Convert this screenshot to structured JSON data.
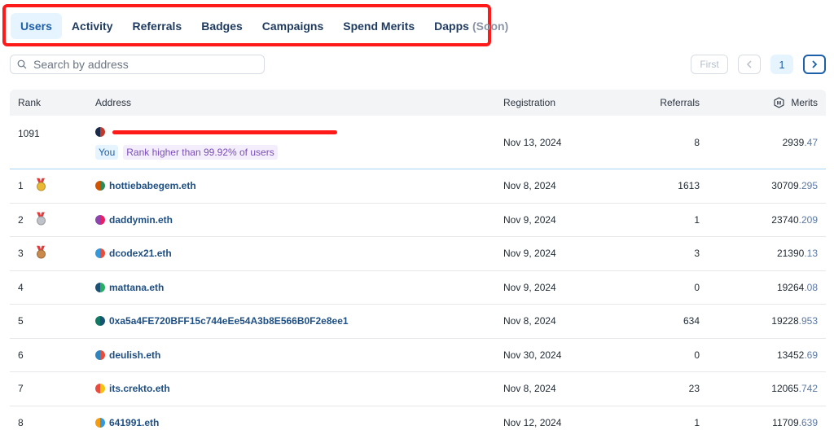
{
  "tabs": [
    {
      "label": "Users",
      "active": true
    },
    {
      "label": "Activity"
    },
    {
      "label": "Referrals"
    },
    {
      "label": "Badges"
    },
    {
      "label": "Campaigns"
    },
    {
      "label": "Spend Merits"
    },
    {
      "label": "Dapps",
      "suffix": "(Soon)"
    }
  ],
  "search": {
    "placeholder": "Search by address",
    "value": ""
  },
  "pagination": {
    "first": "First",
    "current_page": "1"
  },
  "table": {
    "headers": {
      "rank": "Rank",
      "address": "Address",
      "registration": "Registration",
      "referrals": "Referrals",
      "merits": "Merits"
    },
    "you_row": {
      "rank": "1091",
      "address": "",
      "you_label": "You",
      "rank_note": "Rank higher than 99.92% of users",
      "registration": "Nov 13, 2024",
      "referrals": "8",
      "merits_int": "2939",
      "merits_dec": ".47"
    },
    "rows": [
      {
        "rank": "1",
        "medal": "gold",
        "address": "hottiebabegem.eth",
        "registration": "Nov 8, 2024",
        "referrals": "1613",
        "merits_int": "30709",
        "merits_dec": ".295"
      },
      {
        "rank": "2",
        "medal": "silver",
        "address": "daddymin.eth",
        "registration": "Nov 9, 2024",
        "referrals": "1",
        "merits_int": "23740",
        "merits_dec": ".209"
      },
      {
        "rank": "3",
        "medal": "bronze",
        "address": "dcodex21.eth",
        "registration": "Nov 9, 2024",
        "referrals": "3",
        "merits_int": "21390",
        "merits_dec": ".13"
      },
      {
        "rank": "4",
        "address": "mattana.eth",
        "registration": "Nov 9, 2024",
        "referrals": "0",
        "merits_int": "19264",
        "merits_dec": ".08"
      },
      {
        "rank": "5",
        "address": "0xa5a4FE720BFF15c744eEe54A3b8E566B0F2e8ee1",
        "registration": "Nov 8, 2024",
        "referrals": "634",
        "merits_int": "19228",
        "merits_dec": ".953"
      },
      {
        "rank": "6",
        "address": "deulish.eth",
        "registration": "Nov 30, 2024",
        "referrals": "0",
        "merits_int": "13452",
        "merits_dec": ".69"
      },
      {
        "rank": "7",
        "address": "its.crekto.eth",
        "registration": "Nov 8, 2024",
        "referrals": "23",
        "merits_int": "12065",
        "merits_dec": ".742"
      },
      {
        "rank": "8",
        "address": "641991.eth",
        "registration": "Nov 12, 2024",
        "referrals": "1",
        "merits_int": "11709",
        "merits_dec": ".639"
      }
    ]
  },
  "colors": {
    "accent": "#1d5fa8",
    "highlight_box": "#ff1a1a",
    "medal_gold": "#e9b936",
    "medal_silver": "#bfc3c9",
    "medal_bronze": "#c98a4b"
  },
  "avatars": [
    {
      "row": "you",
      "colors": [
        "#c0392b",
        "#1b2a4a"
      ]
    },
    {
      "row": "1",
      "colors": [
        "#2e8b57",
        "#d35400"
      ]
    },
    {
      "row": "2",
      "colors": [
        "#e91e63",
        "#8e44ad"
      ]
    },
    {
      "row": "3",
      "colors": [
        "#e74c3c",
        "#3498db"
      ]
    },
    {
      "row": "4",
      "colors": [
        "#27ae60",
        "#1a5276"
      ]
    },
    {
      "row": "5",
      "colors": [
        "#1a5276",
        "#117a65"
      ]
    },
    {
      "row": "6",
      "colors": [
        "#e74c3c",
        "#2e86c1"
      ]
    },
    {
      "row": "7",
      "colors": [
        "#f1c40f",
        "#e74c3c"
      ]
    },
    {
      "row": "8",
      "colors": [
        "#3498db",
        "#f39c12"
      ]
    }
  ]
}
